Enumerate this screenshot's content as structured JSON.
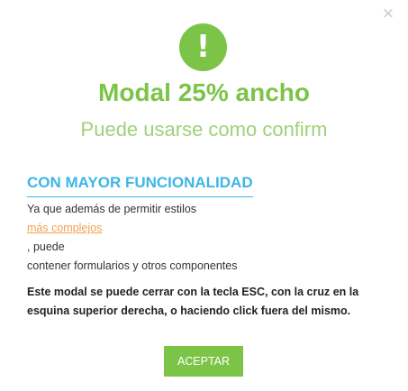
{
  "modal": {
    "close_glyph": "×",
    "icon_glyph": "!",
    "title": "Modal 25% ancho",
    "subtitle": "Puede usarse como confirm",
    "section_heading": "CON MAYOR FUNCIONALIDAD",
    "line1": "Ya que además de permitir estilos",
    "link_text": "más complejos",
    "line2": ", puede",
    "line3": "contener formularios y otros componentes",
    "note": "Este modal se puede cerrar con la tecla ESC, con la cruz en la esquina superior derecha, o haciendo click fuera del mismo.",
    "accept_label": "ACEPTAR"
  },
  "colors": {
    "green": "#7cc447",
    "light_green": "#9fd27a",
    "blue": "#3db6e6",
    "orange": "#f0a04b"
  },
  "icons": {
    "close": "close-icon",
    "alert": "exclamation-icon"
  }
}
